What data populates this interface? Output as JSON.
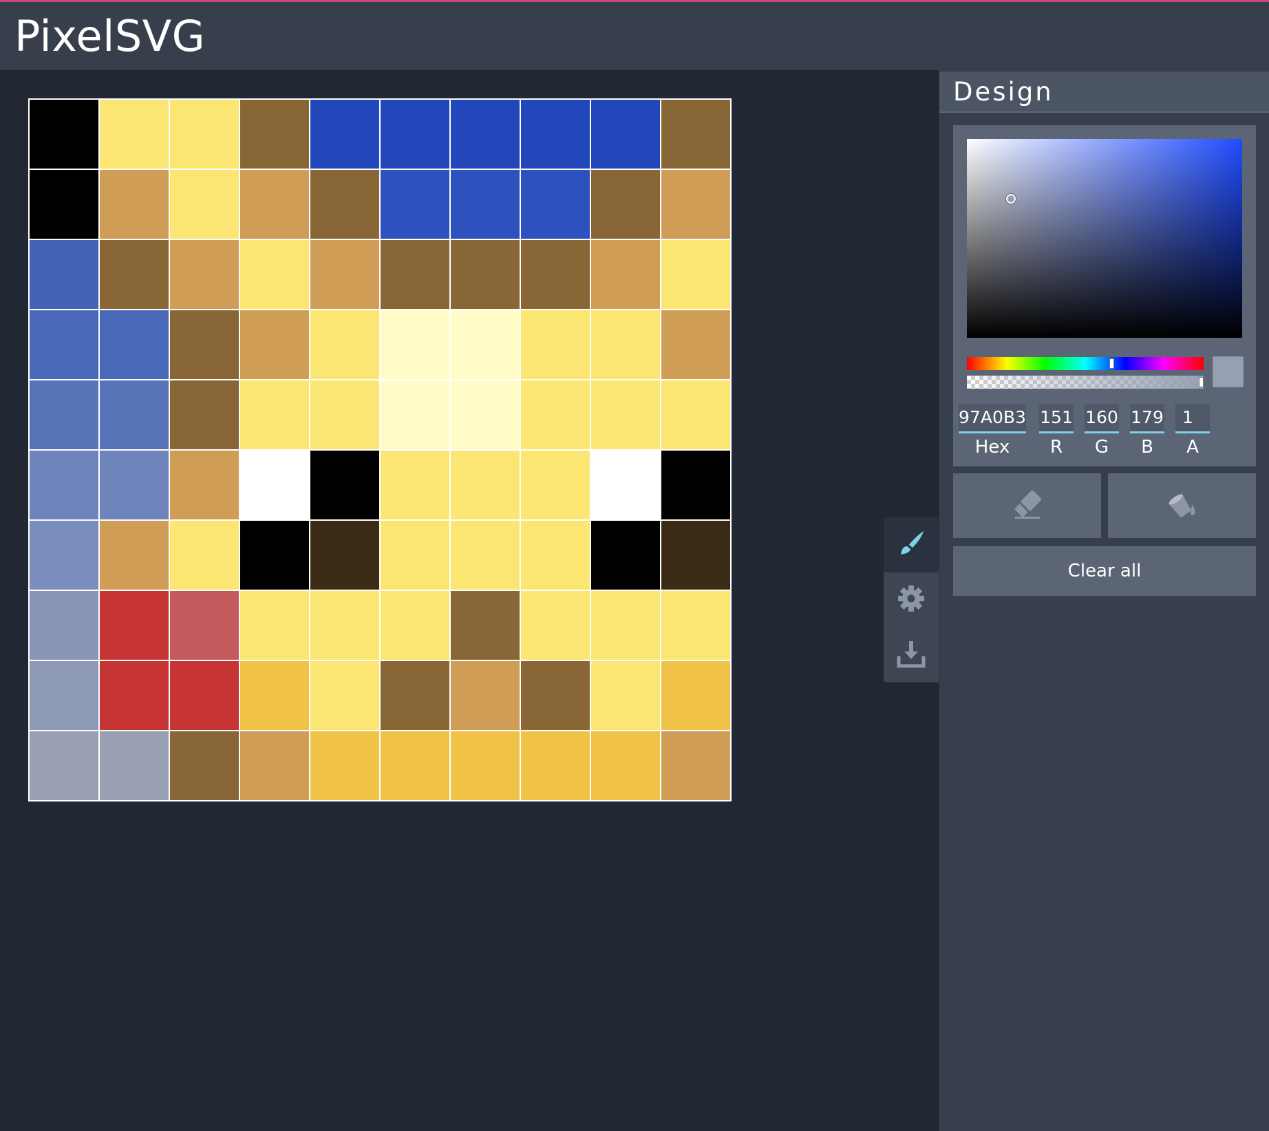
{
  "app": {
    "title": "PixelSVG"
  },
  "canvas": {
    "columns": 10,
    "rows": 10,
    "cells": [
      [
        "#000000",
        "#fbe674",
        "#fbe674",
        "#886636",
        "#2247bb",
        "#2247bb",
        "#2247bb",
        "#2247bb",
        "#2247bb",
        "#886636"
      ],
      [
        "#000000",
        "#d09d57",
        "#fbe674",
        "#d09d57",
        "#886636",
        "#2d52bd",
        "#2d52bd",
        "#2d52bd",
        "#886636",
        "#d09d57"
      ],
      [
        "#4462b8",
        "#886636",
        "#d09d57",
        "#fbe674",
        "#d09d57",
        "#886636",
        "#886636",
        "#886636",
        "#d09d57",
        "#fbe674"
      ],
      [
        "#4a68b8",
        "#4a68b8",
        "#886636",
        "#d09d57",
        "#fbe674",
        "#fffcc8",
        "#fffcc8",
        "#fbe674",
        "#fbe674",
        "#d09d57"
      ],
      [
        "#5874b8",
        "#5874b8",
        "#886636",
        "#fbe674",
        "#fbe674",
        "#fffcc8",
        "#fffcc8",
        "#fbe674",
        "#fbe674",
        "#fbe674"
      ],
      [
        "#6f84bb",
        "#6f84bb",
        "#d09d57",
        "#ffffff",
        "#000000",
        "#fbe674",
        "#fbe674",
        "#fbe674",
        "#ffffff",
        "#000000"
      ],
      [
        "#7a8dbd",
        "#d09d57",
        "#fbe674",
        "#000000",
        "#3b2a16",
        "#fbe674",
        "#fbe674",
        "#fbe674",
        "#000000",
        "#3b2a16"
      ],
      [
        "#8996b8",
        "#c63533",
        "#c35a5d",
        "#fbe674",
        "#fbe674",
        "#fbe674",
        "#886636",
        "#fbe674",
        "#fbe674",
        "#fbe674"
      ],
      [
        "#8e9ab4",
        "#c63533",
        "#c63533",
        "#f0c247",
        "#fbe674",
        "#886636",
        "#d09d57",
        "#886636",
        "#fbe674",
        "#f0c247"
      ],
      [
        "#9aa0b4",
        "#9aa0b4",
        "#886636",
        "#d09d57",
        "#f0c247",
        "#f0c247",
        "#f0c247",
        "#f0c247",
        "#f0c247",
        "#d09d57"
      ]
    ]
  },
  "tools": [
    {
      "name": "brush",
      "icon": "brush-icon",
      "active": true,
      "color": "#7fd0e8"
    },
    {
      "name": "settings",
      "icon": "gear-icon",
      "active": false,
      "color": "#8d96a4"
    },
    {
      "name": "download",
      "icon": "download-icon",
      "active": false,
      "color": "#8d96a4"
    }
  ],
  "panel": {
    "title": "Design",
    "color": {
      "hex": "97A0B3",
      "r": "151",
      "g": "160",
      "b": "179",
      "a": "1",
      "hue_position": 0.61,
      "alpha_position": 1.0,
      "saturation": 0.16,
      "value": 0.7,
      "swatch": "#97a0b3"
    },
    "labels": {
      "hex": "Hex",
      "r": "R",
      "g": "G",
      "b": "B",
      "a": "A"
    },
    "clear_label": "Clear all"
  },
  "colors": {
    "header_bg": "#363f4b",
    "header_accent": "#c9487f",
    "workspace_bg": "#212833",
    "panel_bg": "#363f4b",
    "accent": "#7fd0e8"
  }
}
